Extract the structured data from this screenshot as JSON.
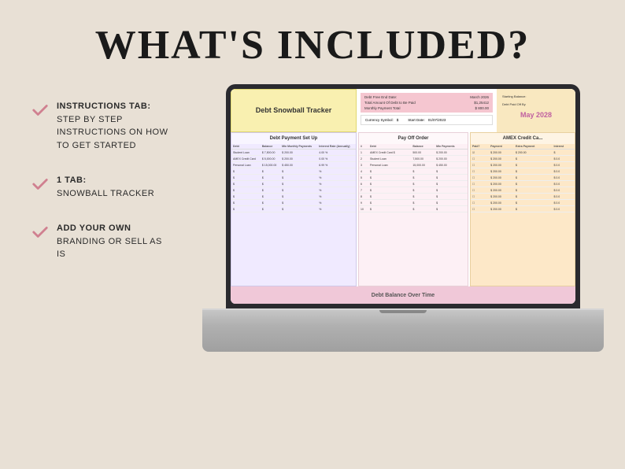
{
  "page": {
    "title": "WHAT'S INCLUDED?",
    "background_color": "#e8e0d5"
  },
  "bullets": [
    {
      "id": "bullet-instructions",
      "bold_text": "INSTRUCTIONS TAB:",
      "sub_text": "STEP BY STEP INSTRUCTIONS ON HOW TO GET STARTED"
    },
    {
      "id": "bullet-tab",
      "bold_text": "1 TAB:",
      "sub_text": "SNOWBALL TRACKER"
    },
    {
      "id": "bullet-branding",
      "bold_text": "ADD YOUR OWN",
      "sub_text": "BRANDING OR SELL AS IS"
    }
  ],
  "spreadsheet": {
    "title": "Debt Snowball Tracker",
    "currency_label": "Currency Symbol:",
    "currency_value": "$",
    "start_date_label": "Start Date:",
    "start_date_value": "01/07/2023",
    "debt_free_end_label": "Debt Free End Date:",
    "debt_free_end_value": "March 2026",
    "total_debt_label": "Total Amount Of Debt to Be Paid",
    "total_debt_value": "$1,25412",
    "monthly_payment_label": "Monthly Payment Total",
    "monthly_payment_value": "$ 800.00",
    "starting_balance_label": "Starting Balance:",
    "debt_paid_by_label": "Debt Paid Off By",
    "debt_paid_by_value": "May 2028",
    "sections": {
      "payment_setup": {
        "title": "Debt Payment Set Up",
        "columns": [
          "Debt",
          "Balance",
          "Min Monthly Payments",
          "Interest Rate (Annually)"
        ],
        "rows": [
          [
            "Student Loan",
            "$ 7,500.00",
            "$ 200.00",
            "4.00 %"
          ],
          [
            "AMEX Credit Card",
            "$ 5,000.00",
            "$ 200.00",
            "0.00 %"
          ],
          [
            "Personal Loan",
            "$ 15,000.00",
            "$ 450.00",
            "6.99 %"
          ],
          [
            "$",
            "$",
            "$",
            "%"
          ],
          [
            "$",
            "$",
            "$",
            "%"
          ],
          [
            "$",
            "$",
            "$",
            "%"
          ],
          [
            "$",
            "$",
            "$",
            "%"
          ],
          [
            "$",
            "$",
            "$",
            "%"
          ],
          [
            "$",
            "$",
            "$",
            "%"
          ],
          [
            "$",
            "$",
            "$",
            "%"
          ]
        ]
      },
      "pay_off_order": {
        "title": "Pay Off Order",
        "columns": [
          "Debt",
          "Balance",
          "Min Payments"
        ],
        "rows": [
          [
            "1",
            "AMEX Credit Card $",
            "500.00",
            "$ 200.00"
          ],
          [
            "2",
            "Student Loan",
            "7,500.00",
            "$ 200.00"
          ],
          [
            "3",
            "Personal Loan",
            "15,000.00",
            "$ 450.00"
          ],
          [
            "4",
            "$",
            "$",
            "$"
          ],
          [
            "5",
            "$",
            "$",
            "$"
          ],
          [
            "6",
            "$",
            "$",
            "$"
          ],
          [
            "7",
            "$",
            "$",
            "$"
          ],
          [
            "8",
            "$",
            "$",
            "$"
          ],
          [
            "9",
            "$",
            "$",
            "$"
          ],
          [
            "10",
            "$",
            "$",
            "$"
          ]
        ]
      },
      "credit_card": {
        "title": "AMEX Credit Ca...",
        "columns": [
          "Paid?",
          "Payment",
          "Extra Payment",
          "Interest"
        ],
        "rows": [
          [
            "☑",
            "$ 200.00",
            "$ 200.00",
            "$"
          ],
          [
            "☐",
            "$ 200.00",
            "$",
            "$ 0.0"
          ],
          [
            "☐",
            "$ 200.00",
            "$",
            "$ 0.0"
          ],
          [
            "☐",
            "$ 200.00",
            "$",
            "$ 0.0"
          ],
          [
            "☐",
            "$ 200.00",
            "$",
            "$ 0.0"
          ],
          [
            "☐",
            "$ 200.00",
            "$",
            "$ 0.0"
          ],
          [
            "☐",
            "$ 200.00",
            "$",
            "$ 0.0"
          ],
          [
            "☐",
            "$ 200.00",
            "$",
            "$ 0.0"
          ],
          [
            "☐",
            "$ 200.00",
            "$",
            "$ 0.0"
          ],
          [
            "☐",
            "$ 200.00",
            "$",
            "$ 0.0"
          ]
        ]
      }
    },
    "footer": "Debt Balance Over Time"
  },
  "icons": {
    "check": "✓"
  }
}
